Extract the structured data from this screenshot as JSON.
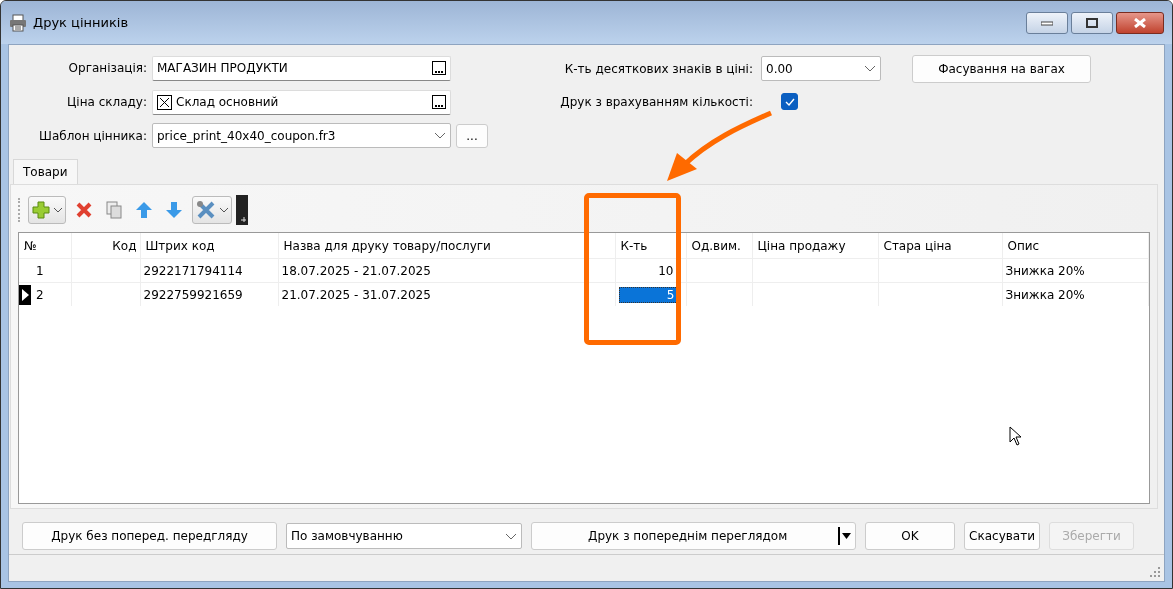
{
  "window": {
    "title": "Друк цінників"
  },
  "form": {
    "organization": {
      "label": "Організація:",
      "value": "МАГАЗИН ПРОДУКТИ"
    },
    "warehouse_price": {
      "label": "Ціна складу:",
      "value": "Склад основний"
    },
    "template": {
      "label": "Шаблон цінника:",
      "value": "price_print_40x40_coupon.fr3",
      "button": "..."
    },
    "decimals": {
      "label": "К-ть десяткових знаків в ціні:",
      "value": "0.00"
    },
    "weighing_button": "Фасування на вагах",
    "print_with_quantity": {
      "label": "Друк з врахуванням кількості:",
      "checked": true
    }
  },
  "tabs": [
    {
      "label": "Товари",
      "selected": true
    }
  ],
  "table": {
    "columns": [
      "№",
      "Код",
      "Штрих код",
      "Назва для друку товару/послуги",
      "К-ть",
      "Од.вим.",
      "Ціна продажу",
      "Стара ціна",
      "Опис"
    ],
    "rows": [
      {
        "selected": false,
        "cells": [
          "1",
          "",
          "2922171794114",
          "18.07.2025 - 21.07.2025",
          "10",
          "",
          "",
          "",
          "Знижка 20%"
        ]
      },
      {
        "selected": true,
        "cells": [
          "2",
          "",
          "2922759921659",
          "21.07.2025 - 31.07.2025",
          "5",
          "",
          "",
          "",
          "Знижка 20%"
        ]
      }
    ]
  },
  "footer": {
    "print_without_preview": "Друк без поперед. передгляду",
    "printer": "По замовчуванню",
    "print_with_preview": "Друк з попереднім переглядом",
    "buttons": [
      {
        "label": "OK",
        "disabled": false
      },
      {
        "label": "Скасувати",
        "disabled": false
      },
      {
        "label": "Зберегти",
        "disabled": true
      }
    ]
  }
}
